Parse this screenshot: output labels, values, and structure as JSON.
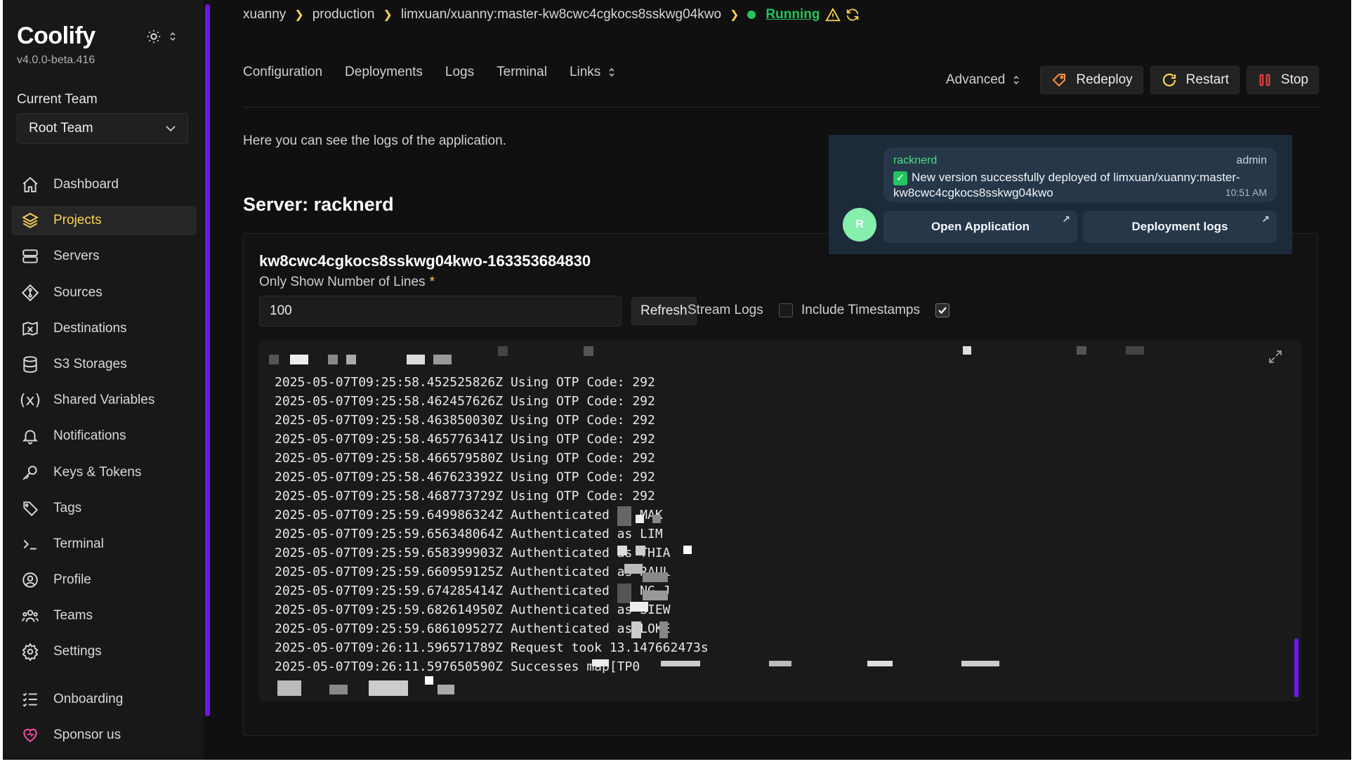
{
  "app": {
    "name": "Coolify",
    "version": "v4.0.0-beta.416"
  },
  "team": {
    "label": "Current Team",
    "selected": "Root Team"
  },
  "nav": {
    "items": [
      {
        "label": "Dashboard",
        "icon": "home-icon"
      },
      {
        "label": "Projects",
        "icon": "layers-icon",
        "active": true
      },
      {
        "label": "Servers",
        "icon": "server-icon"
      },
      {
        "label": "Sources",
        "icon": "git-icon"
      },
      {
        "label": "Destinations",
        "icon": "destination-icon"
      },
      {
        "label": "S3 Storages",
        "icon": "database-icon"
      },
      {
        "label": "Shared Variables",
        "icon": "variable-icon"
      },
      {
        "label": "Notifications",
        "icon": "bell-icon"
      },
      {
        "label": "Keys & Tokens",
        "icon": "key-icon"
      },
      {
        "label": "Tags",
        "icon": "tag-icon"
      },
      {
        "label": "Terminal",
        "icon": "terminal-icon"
      },
      {
        "label": "Profile",
        "icon": "user-circle-icon"
      },
      {
        "label": "Teams",
        "icon": "team-icon"
      },
      {
        "label": "Settings",
        "icon": "gear-icon"
      }
    ],
    "bottom": [
      {
        "label": "Onboarding",
        "icon": "checklist-icon"
      },
      {
        "label": "Sponsor us",
        "icon": "heart-icon"
      }
    ]
  },
  "breadcrumb": {
    "team": "xuanny",
    "environment": "production",
    "resource": "limxuan/xuanny:master-kw8cwc4cgkocs8sskwg04kwo",
    "status": "Running"
  },
  "tabs": [
    "Configuration",
    "Deployments",
    "Logs",
    "Terminal",
    "Links"
  ],
  "actions": {
    "advanced": "Advanced",
    "redeploy": "Redeploy",
    "restart": "Restart",
    "stop": "Stop"
  },
  "page": {
    "help": "Here you can see the logs of the application.",
    "server_title": "Server: racknerd"
  },
  "logs": {
    "container": "kw8cwc4cgkocs8sskwg04kwo-163353684830",
    "lines_label": "Only Show Number of Lines",
    "lines_value": "100",
    "refresh": "Refresh",
    "stream_label": "Stream Logs",
    "timestamps_label": "Include Timestamps",
    "lines": [
      "2025-05-07T09:25:58.452525826Z Using OTP Code: 292",
      "2025-05-07T09:25:58.462457626Z Using OTP Code: 292",
      "2025-05-07T09:25:58.463850030Z Using OTP Code: 292",
      "2025-05-07T09:25:58.465776341Z Using OTP Code: 292",
      "2025-05-07T09:25:58.466579580Z Using OTP Code: 292",
      "2025-05-07T09:25:58.467623392Z Using OTP Code: 292",
      "2025-05-07T09:25:58.468773729Z Using OTP Code: 292",
      "2025-05-07T09:25:59.649986324Z Authenticated as MAK",
      "2025-05-07T09:25:59.656348064Z Authenticated as LIM",
      "2025-05-07T09:25:59.658399903Z Authenticated as THIA",
      "2025-05-07T09:25:59.660959125Z Authenticated as RAUL",
      "2025-05-07T09:25:59.674285414Z Authenticated as NG J",
      "2025-05-07T09:25:59.682614950Z Authenticated as SIEW",
      "2025-05-07T09:25:59.686109527Z Authenticated as LOKE",
      "2025-05-07T09:26:11.596571789Z Request took 13.147662473s",
      "2025-05-07T09:26:11.597650590Z Successes map[TP0"
    ]
  },
  "toast": {
    "sender": "racknerd",
    "role": "admin",
    "message": "New version successfully deployed of limxuan/xuanny:master-kw8cwc4cgkocs8sskwg04kwo",
    "time": "10:51 AM",
    "avatar": "R",
    "open_app": "Open Application",
    "deploy_logs": "Deployment logs"
  },
  "colors": {
    "accent": "#fcd34d",
    "brand_scroll": "#6b16ed",
    "running": "#22c55e",
    "toast_bg": "#1d2a3a"
  }
}
